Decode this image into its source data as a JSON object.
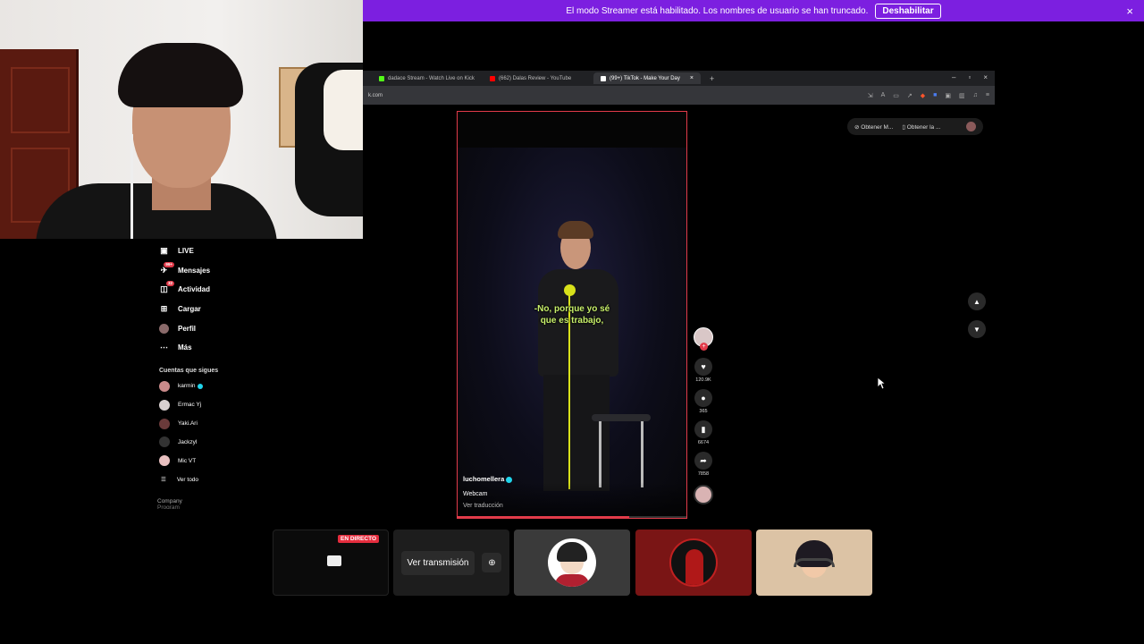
{
  "streamer_banner": {
    "message": "El modo Streamer está habilitado. Los nombres de usuario se han truncado.",
    "button": "Deshabilitar",
    "close_icon": "×"
  },
  "browser": {
    "tabs": [
      {
        "label": "dadace Stream - Watch Live on Kick",
        "close": "",
        "favicon_color": "#53fc18"
      },
      {
        "label": "(662) Dalas Review - YouTube",
        "close": "",
        "favicon_color": "#ff0000"
      },
      {
        "label": "(99+) TikTok - Make Your Day",
        "close": "×",
        "favicon_color": "#ffffff"
      }
    ],
    "new_tab": "+",
    "window_controls": {
      "minimize": "–",
      "maximize": "▫",
      "close": "×"
    },
    "url": "k.com"
  },
  "get_buttons": {
    "first": "Obtener M...",
    "second": "Obtener la ..."
  },
  "video": {
    "caption_line1": "-No, porque yo sé",
    "caption_line2": "que es trabajo,",
    "author": "luchomellera",
    "description": "Webcam",
    "translate": "Ver traducción",
    "progress": 0.75
  },
  "actions": {
    "likes": "120.9K",
    "comments": "365",
    "saves": "6674",
    "shares": "7858"
  },
  "sidebar": {
    "items": [
      {
        "label": "LIVE",
        "icon": "live-icon",
        "badge": ""
      },
      {
        "label": "Mensajes",
        "icon": "messages-icon",
        "badge": "99+"
      },
      {
        "label": "Actividad",
        "icon": "activity-icon",
        "badge": "32"
      },
      {
        "label": "Cargar",
        "icon": "upload-icon",
        "badge": ""
      },
      {
        "label": "Perfil",
        "icon": "profile-icon",
        "badge": ""
      },
      {
        "label": "Más",
        "icon": "more-icon",
        "badge": ""
      }
    ],
    "following_header": "Cuentas que sigues",
    "following": [
      {
        "name": "karmin",
        "verified": true,
        "color": "#c98a8a"
      },
      {
        "name": "Ermac Yj",
        "verified": false,
        "color": "#d8d0d0"
      },
      {
        "name": "Yaki.Ari",
        "verified": false,
        "color": "#6a3a3a"
      },
      {
        "name": "Jackzyl",
        "verified": false,
        "color": "#333333"
      },
      {
        "name": "Mic VT",
        "verified": false,
        "color": "#e8c0c0"
      }
    ],
    "see_all": "Ver todo",
    "company": "Company",
    "program": "Program"
  },
  "participants": {
    "live_badge": "EN DIRECTO",
    "watch_stream": "Ver transmisión"
  },
  "colors": {
    "banner": "#7c1fe0",
    "accent": "#e23b4a",
    "caption": "#c8f06a"
  }
}
